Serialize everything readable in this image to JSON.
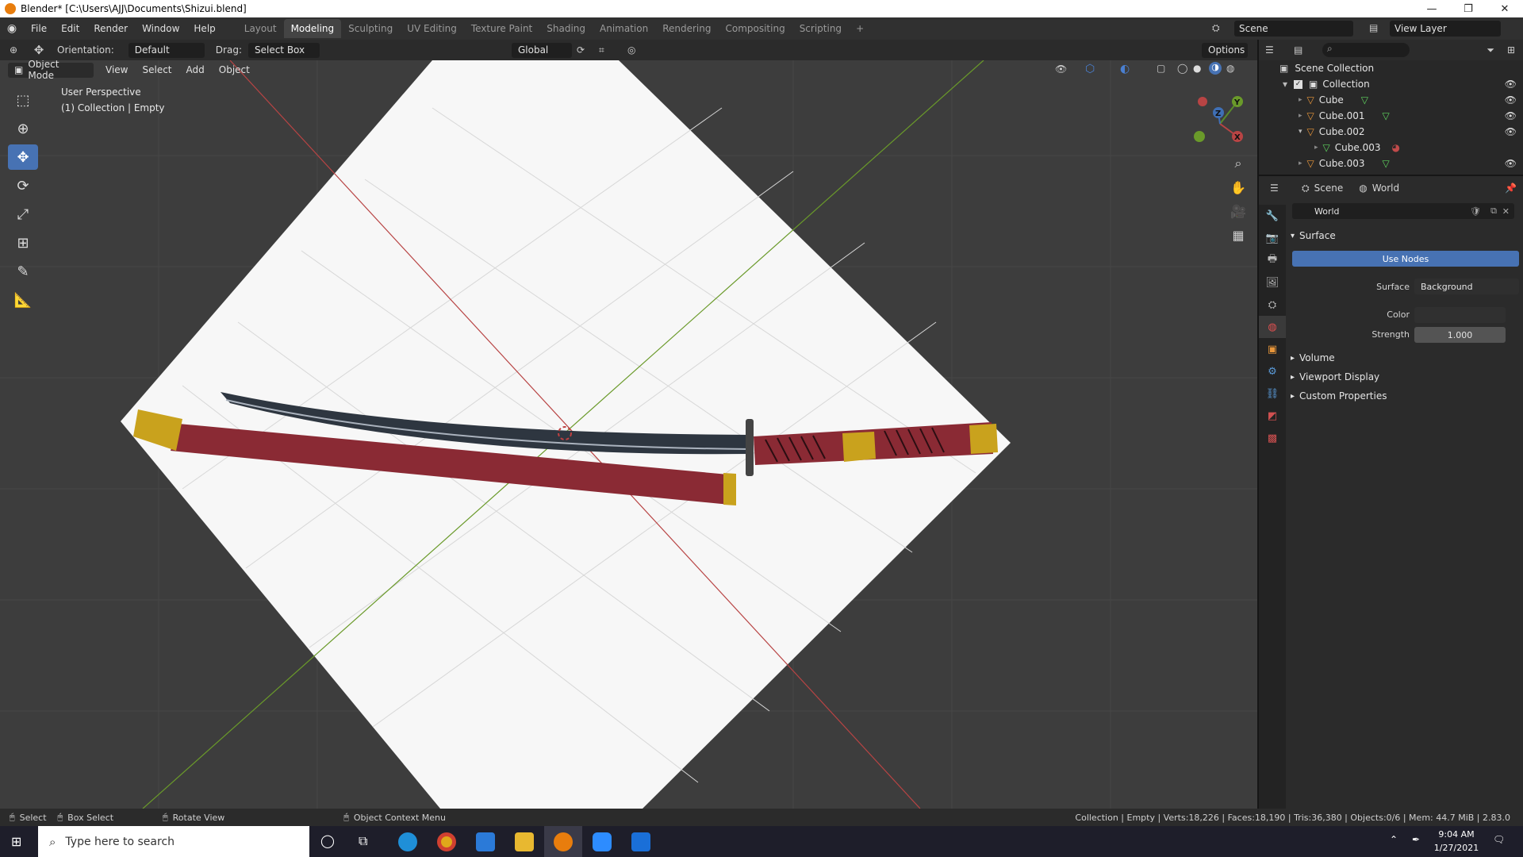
{
  "window": {
    "title": "Blender* [C:\\Users\\AJJ\\Documents\\Shizui.blend]",
    "controls": [
      "—",
      "❐",
      "✕"
    ]
  },
  "menu": [
    "File",
    "Edit",
    "Render",
    "Window",
    "Help"
  ],
  "workspaces": [
    "Layout",
    "Modeling",
    "Sculpting",
    "UV Editing",
    "Texture Paint",
    "Shading",
    "Animation",
    "Rendering",
    "Compositing",
    "Scripting",
    "+"
  ],
  "active_workspace": "Modeling",
  "scene_name": "Scene",
  "view_layer": "View Layer",
  "toolheader": {
    "orientation_label": "Orientation:",
    "orientation_value": "Default",
    "drag_label": "Drag:",
    "drag_value": "Select Box",
    "transform_orientation": "Global",
    "options": "Options"
  },
  "vpheader": {
    "mode": "Object Mode",
    "menus": [
      "View",
      "Select",
      "Add",
      "Object"
    ]
  },
  "viewport": {
    "view_name": "User Perspective",
    "selection_info": "(1) Collection | Empty",
    "gizmo_axes": [
      "Z",
      "Y",
      "X"
    ]
  },
  "outliner": {
    "root": "Scene Collection",
    "items": [
      {
        "name": "Collection",
        "type": "collection"
      },
      {
        "name": "Cube",
        "type": "mesh"
      },
      {
        "name": "Cube.001",
        "type": "mesh"
      },
      {
        "name": "Cube.002",
        "type": "mesh"
      },
      {
        "name": "Cube.003",
        "type": "mesh-child"
      },
      {
        "name": "Cube.003",
        "type": "mesh"
      }
    ]
  },
  "properties": {
    "context_scene": "Scene",
    "context_world": "World",
    "world_name": "World",
    "surface_section": "Surface",
    "use_nodes": "Use Nodes",
    "surface_label": "Surface",
    "surface_value": "Background",
    "color_label": "Color",
    "strength_label": "Strength",
    "strength_value": "1.000",
    "collapsed_sections": [
      "Volume",
      "Viewport Display",
      "Custom Properties"
    ]
  },
  "statusbar": {
    "select": "Select",
    "box_select": "Box Select",
    "rotate_view": "Rotate View",
    "context_menu": "Object Context Menu",
    "stats": "Collection | Empty | Verts:18,226 | Faces:18,190 | Tris:36,380 | Objects:0/6 | Mem: 44.7 MiB | 2.83.0"
  },
  "taskbar": {
    "search_placeholder": "Type here to search",
    "time": "9:04 AM",
    "date": "1/27/2021"
  },
  "colors": {
    "accent": "#4772b3",
    "scabbard": "#8a2a34",
    "gold": "#c9a21d",
    "blade": "#2e3640",
    "x_axis": "#b84444",
    "y_axis": "#6a9a2a"
  }
}
